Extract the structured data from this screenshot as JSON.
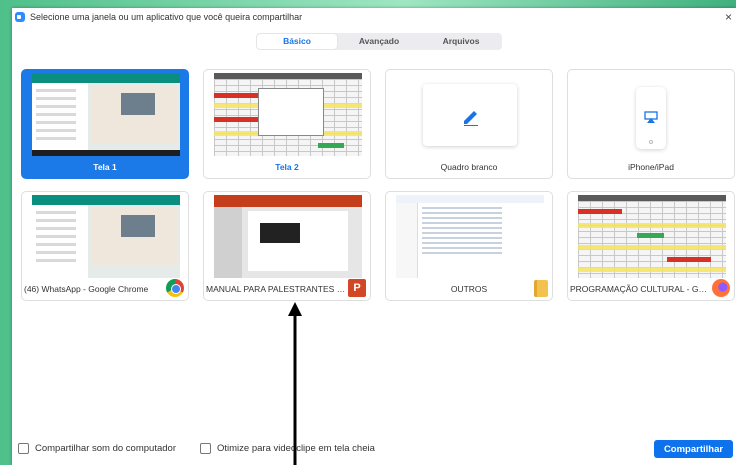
{
  "dialog": {
    "title": "Selecione uma janela ou um aplicativo que você queira compartilhar",
    "close_glyph": "×"
  },
  "tabs": [
    {
      "label": "Básico",
      "active": true
    },
    {
      "label": "Avançado",
      "active": false
    },
    {
      "label": "Arquivos",
      "active": false
    }
  ],
  "cards": [
    {
      "label": "Tela 1",
      "selected": true,
      "icon": "screen-thumbnail"
    },
    {
      "label": "Tela 2",
      "selected": false,
      "icon": "screen-thumbnail"
    },
    {
      "label": "Quadro branco",
      "selected": false,
      "icon": "pencil-icon"
    },
    {
      "label": "iPhone/iPad",
      "selected": false,
      "icon": "airplay-icon"
    },
    {
      "label": "(46) WhatsApp - Google Chrome",
      "selected": false,
      "icon": "chrome-icon"
    },
    {
      "label": "MANUAL PARA PALESTRANTES C...",
      "selected": false,
      "icon": "powerpoint-icon",
      "icon_text": "P"
    },
    {
      "label": "OUTROS",
      "selected": false,
      "icon": "folder-icon"
    },
    {
      "label": "PROGRAMAÇÃO CULTURAL - Go...",
      "selected": false,
      "icon": "firefox-icon"
    }
  ],
  "footer": {
    "share_sound_label": "Compartilhar som do computador",
    "optimize_label": "Otimize para videoclipe em tela cheia",
    "share_sound_checked": false,
    "optimize_checked": false,
    "share_button_label": "Compartilhar"
  },
  "colors": {
    "accent": "#0e72ed",
    "selected_card": "#1c79e8",
    "background": "#4fc08a"
  }
}
